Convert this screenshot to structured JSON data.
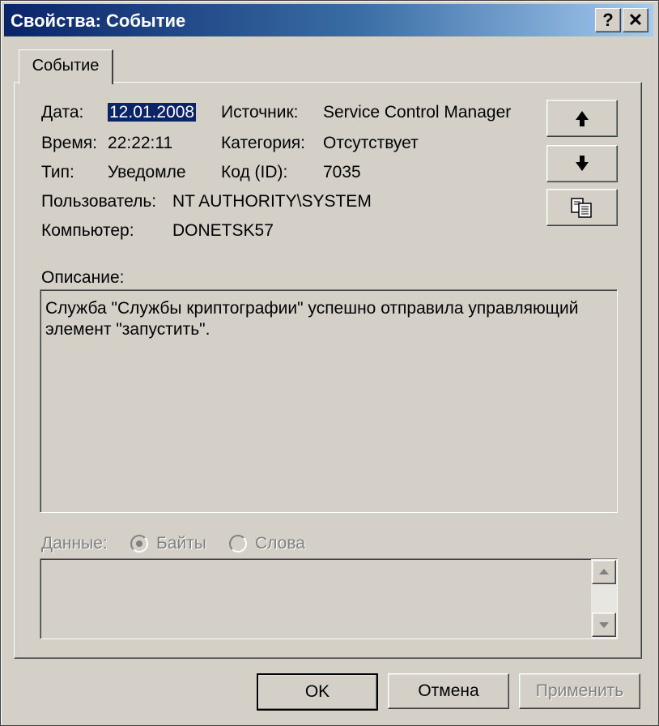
{
  "window": {
    "title": "Свойства: Событие",
    "help_label": "?",
    "close_label": "✕"
  },
  "tab": {
    "label": "Событие"
  },
  "fields": {
    "date_label": "Дата:",
    "date_value": "12.01.2008",
    "time_label": "Время:",
    "time_value": "22:22:11",
    "type_label": "Тип:",
    "type_value": "Уведомле",
    "user_label": "Пользователь:",
    "user_value": "NT AUTHORITY\\SYSTEM",
    "computer_label": "Компьютер:",
    "computer_value": "DONETSK57",
    "source_label": "Источник:",
    "source_value": "Service Control Manager",
    "category_label": "Категория:",
    "category_value": "Отсутствует",
    "id_label": "Код (ID):",
    "id_value": "7035"
  },
  "nav_buttons": {
    "up_icon": "arrow-up-icon",
    "down_icon": "arrow-down-icon",
    "copy_icon": "copy-icon"
  },
  "description": {
    "label": "Описание:",
    "text": "Служба \"Службы криптографии\" успешно отправила управляющий элемент \"запустить\"."
  },
  "data": {
    "label": "Данные:",
    "bytes_label": "Байты",
    "words_label": "Слова",
    "selected": "Байты"
  },
  "buttons": {
    "ok": "OK",
    "cancel": "Отмена",
    "apply": "Применить"
  },
  "colors": {
    "titlebar_start": "#0a246a",
    "titlebar_end": "#a6caf0",
    "face": "#d4d0c8",
    "disabled": "#808080"
  }
}
